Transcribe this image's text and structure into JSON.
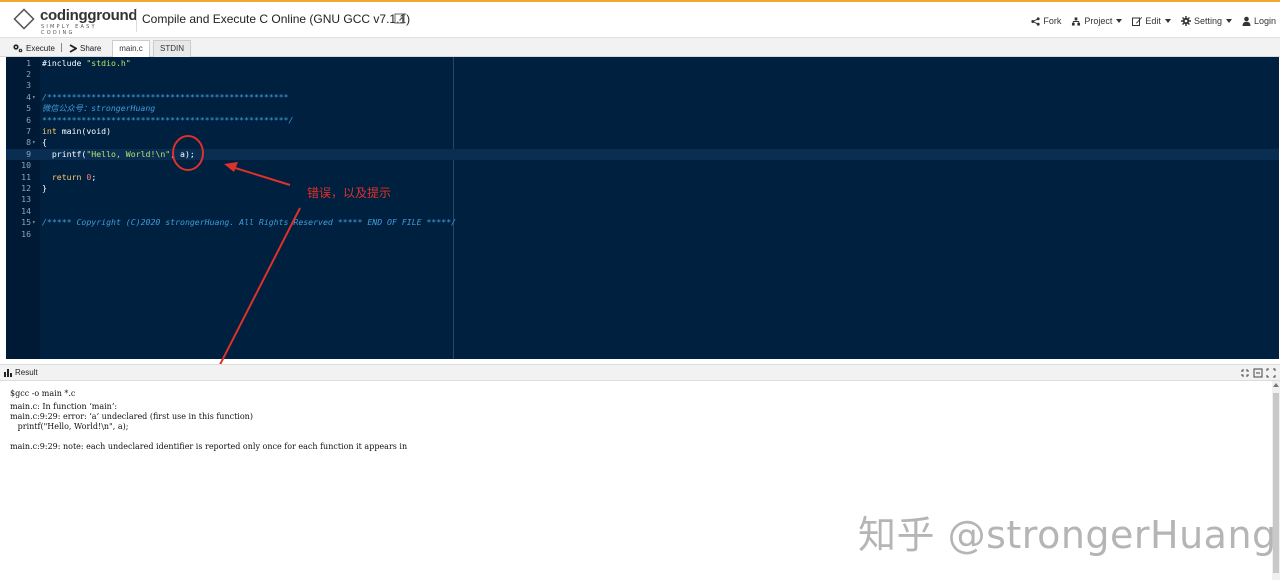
{
  "header": {
    "logo_name": "codingground",
    "logo_tagline": "SIMPLY EASY CODING",
    "title": "Compile and Execute C Online (GNU GCC v7.1.1)",
    "nav": {
      "fork": "Fork",
      "project": "Project",
      "edit": "Edit",
      "setting": "Setting",
      "login": "Login"
    }
  },
  "toolbar": {
    "execute": "Execute",
    "share": "Share",
    "tabs": [
      "main.c",
      "STDIN"
    ],
    "active_tab": "main.c"
  },
  "editor": {
    "current_line": 9,
    "lines": [
      {
        "num": "1",
        "fold": "",
        "tokens": [
          {
            "c": "t-plain",
            "t": "#include "
          },
          {
            "c": "t-str",
            "t": "\"stdio.h\""
          }
        ]
      },
      {
        "num": "2",
        "fold": "",
        "tokens": []
      },
      {
        "num": "3",
        "fold": "",
        "tokens": []
      },
      {
        "num": "4",
        "fold": "▾",
        "tokens": [
          {
            "c": "t-com",
            "t": "/*************************************************"
          }
        ]
      },
      {
        "num": "5",
        "fold": "",
        "tokens": [
          {
            "c": "t-com",
            "t": "微信公众号：strongerHuang"
          }
        ]
      },
      {
        "num": "6",
        "fold": "",
        "tokens": [
          {
            "c": "t-com",
            "t": "**************************************************/"
          }
        ]
      },
      {
        "num": "7",
        "fold": "",
        "tokens": [
          {
            "c": "t-kw",
            "t": "int "
          },
          {
            "c": "t-plain",
            "t": "main(void)"
          }
        ]
      },
      {
        "num": "8",
        "fold": "▾",
        "tokens": [
          {
            "c": "t-plain",
            "t": "{"
          }
        ]
      },
      {
        "num": "9",
        "fold": "",
        "tokens": [
          {
            "c": "t-plain",
            "t": "  printf("
          },
          {
            "c": "t-str",
            "t": "\"Hello, World!\\n\""
          },
          {
            "c": "t-plain",
            "t": ", a);"
          }
        ]
      },
      {
        "num": "10",
        "fold": "",
        "tokens": []
      },
      {
        "num": "11",
        "fold": "",
        "tokens": [
          {
            "c": "t-kw",
            "t": "  return "
          },
          {
            "c": "t-num",
            "t": "0"
          },
          {
            "c": "t-plain",
            "t": ";"
          }
        ]
      },
      {
        "num": "12",
        "fold": "",
        "tokens": [
          {
            "c": "t-plain",
            "t": "}"
          }
        ]
      },
      {
        "num": "13",
        "fold": "",
        "tokens": []
      },
      {
        "num": "14",
        "fold": "",
        "tokens": []
      },
      {
        "num": "15",
        "fold": "▾",
        "tokens": [
          {
            "c": "t-com",
            "t": "/***** Copyright (C)2020 strongerHuang. All Rights Reserved ***** END OF FILE *****/"
          }
        ]
      },
      {
        "num": "16",
        "fold": "",
        "tokens": []
      }
    ]
  },
  "annotation": {
    "text": "错误，以及提示",
    "color": "#e0302a"
  },
  "result": {
    "title": "Result",
    "output": [
      "$gcc -o main *.c",
      "main.c: In function ‘main’:",
      "main.c:9:29: error: ‘a’ undeclared (first use in this function)",
      "   printf(\"Hello, World!\\n\", a);",
      "",
      "main.c:9:29: note: each undeclared identifier is reported only once for each function it appears in"
    ]
  },
  "watermark": "知乎 @strongerHuang",
  "colors": {
    "editor_bg": "#00203f",
    "accent_top": "#f0a830",
    "annotation": "#e0302a"
  }
}
